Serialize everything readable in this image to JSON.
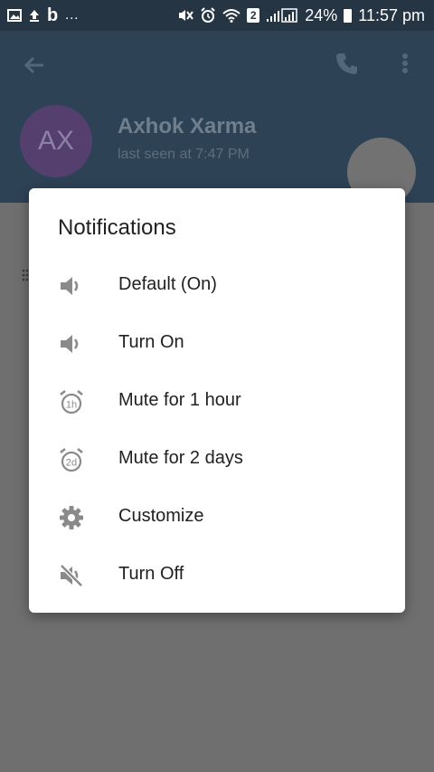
{
  "status_bar": {
    "left_text": "…",
    "battery": "24%",
    "sim": "2",
    "time": "11:57 pm"
  },
  "header": {
    "avatar_initials": "AX",
    "contact_name": "Axhok Xarma",
    "last_seen": "last seen at 7:47 PM"
  },
  "dialog": {
    "title": "Notifications",
    "items": [
      {
        "label": "Default (On)",
        "icon": "speaker-icon"
      },
      {
        "label": "Turn On",
        "icon": "speaker-icon"
      },
      {
        "label": "Mute for 1 hour",
        "icon": "alarm-1h-icon",
        "badge": "1h"
      },
      {
        "label": "Mute for 2 days",
        "icon": "alarm-2d-icon",
        "badge": "2d"
      },
      {
        "label": "Customize",
        "icon": "gear-icon"
      },
      {
        "label": "Turn Off",
        "icon": "speaker-muted-icon"
      }
    ]
  },
  "colors": {
    "status_bar": "#263544",
    "app_bar": "#2d4255",
    "scrim": "#6f6f6f",
    "dialog_bg": "#ffffff",
    "icon": "#8a8a8a"
  }
}
